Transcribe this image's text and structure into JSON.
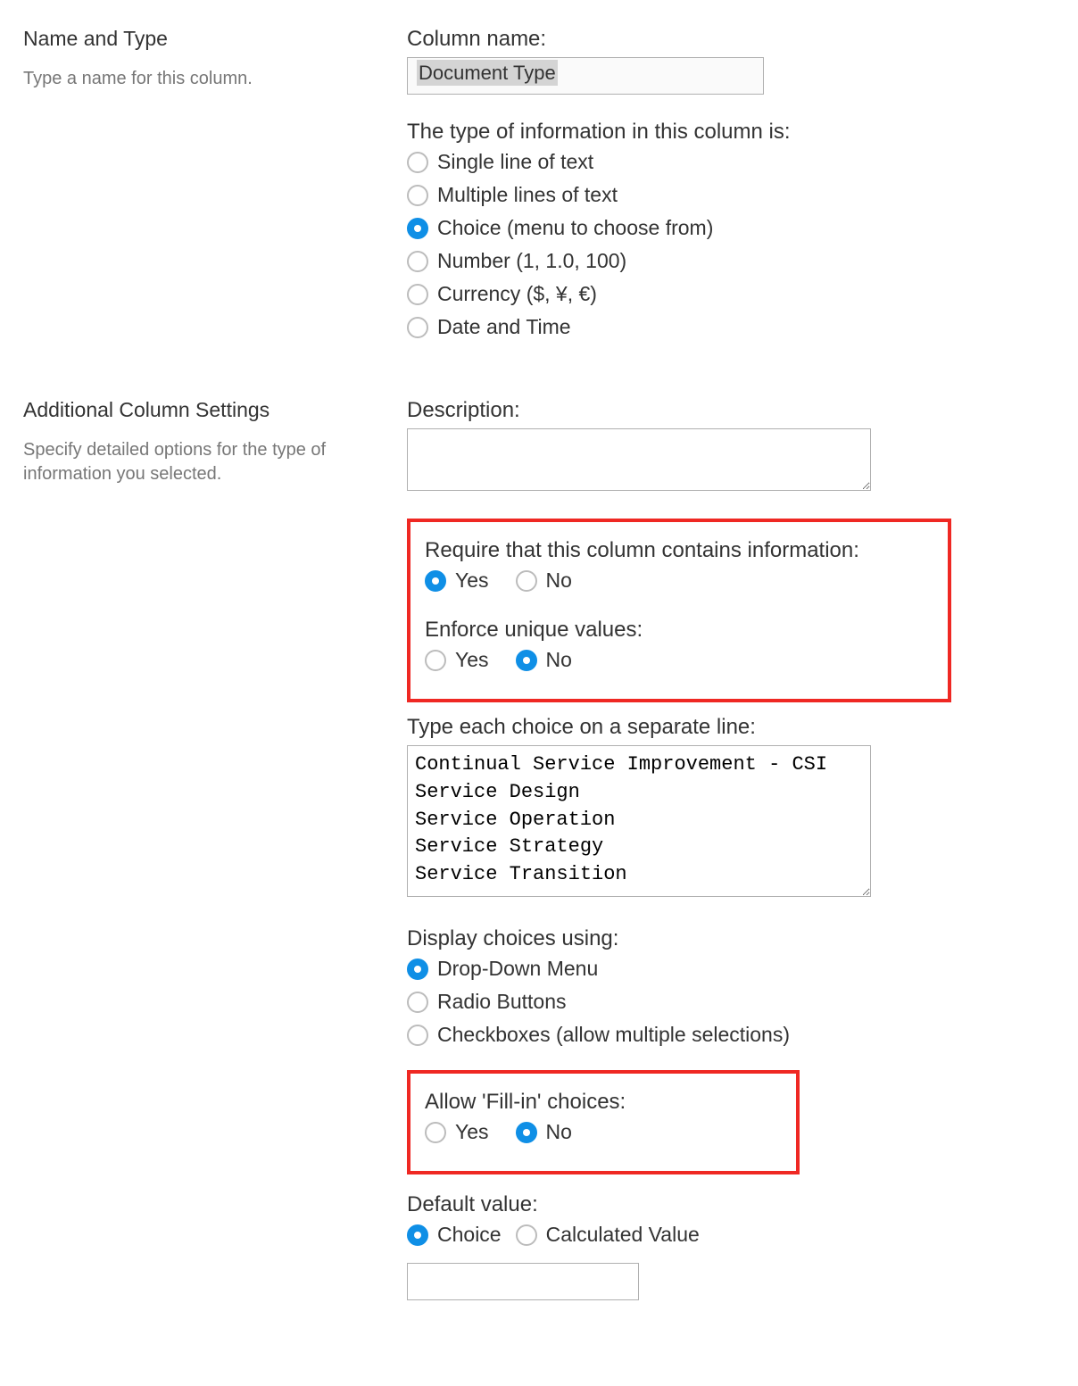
{
  "section1": {
    "title": "Name and Type",
    "desc": "Type a name for this column."
  },
  "columnName": {
    "label": "Column name:",
    "value": "Document Type"
  },
  "typeInfo": {
    "label": "The type of information in this column is:",
    "options": [
      "Single line of text",
      "Multiple lines of text",
      "Choice (menu to choose from)",
      "Number (1, 1.0, 100)",
      "Currency ($, ¥, €)",
      "Date and Time"
    ],
    "selectedIndex": 2
  },
  "section2": {
    "title": "Additional Column Settings",
    "desc": "Specify detailed options for the type of information you selected."
  },
  "description": {
    "label": "Description:",
    "value": ""
  },
  "require": {
    "label": "Require that this column contains information:",
    "yes": "Yes",
    "no": "No",
    "selected": "yes"
  },
  "unique": {
    "label": "Enforce unique values:",
    "yes": "Yes",
    "no": "No",
    "selected": "no"
  },
  "choicesLabel": "Type each choice on a separate line:",
  "choices": "Continual Service Improvement - CSI\nService Design\nService Operation\nService Strategy\nService Transition",
  "display": {
    "label": "Display choices using:",
    "options": [
      "Drop-Down Menu",
      "Radio Buttons",
      "Checkboxes (allow multiple selections)"
    ],
    "selectedIndex": 0
  },
  "fillin": {
    "label": "Allow 'Fill-in' choices:",
    "yes": "Yes",
    "no": "No",
    "selected": "no"
  },
  "defaultValue": {
    "label": "Default value:",
    "choice": "Choice",
    "calc": "Calculated Value",
    "selected": "choice",
    "input": ""
  }
}
